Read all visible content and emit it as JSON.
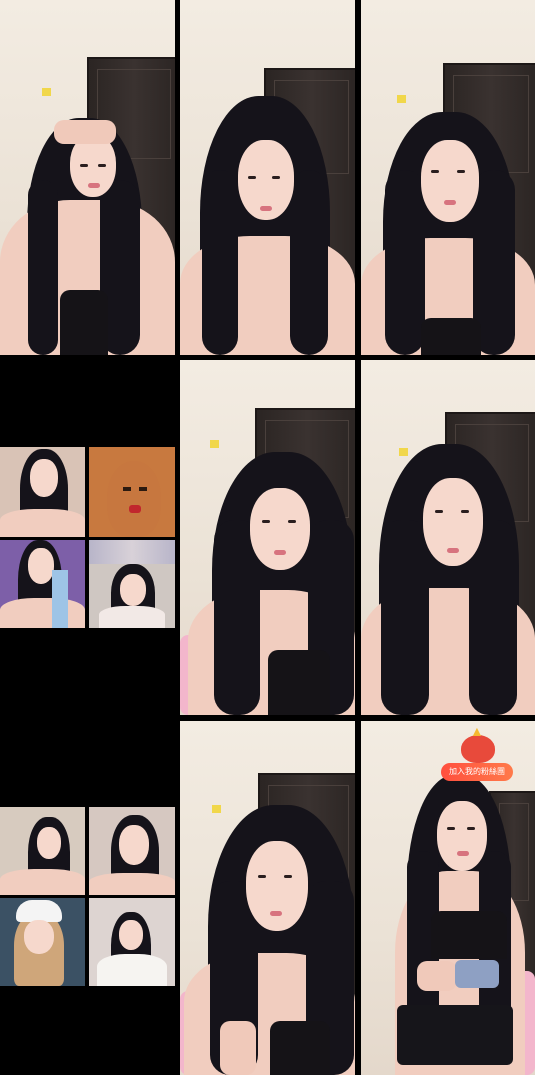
{
  "badge": {
    "text": "加入我的粉絲團"
  },
  "colors": {
    "accent": "#e84a3b",
    "pill": "#ff5a40"
  }
}
